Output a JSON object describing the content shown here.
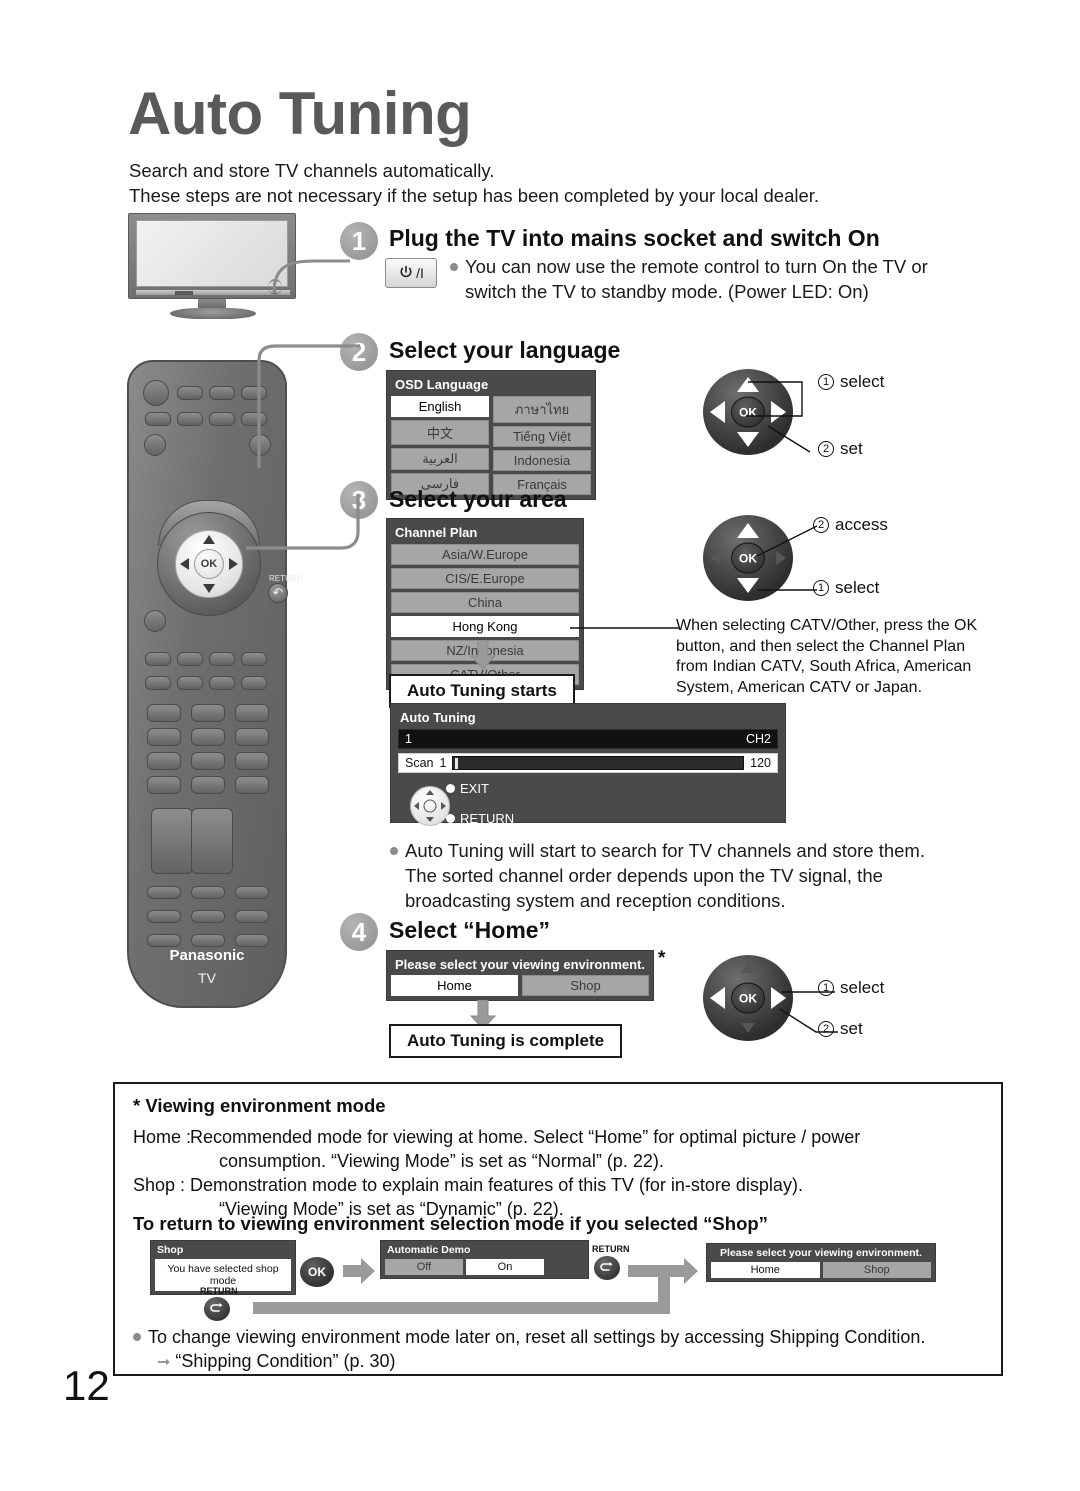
{
  "page": {
    "title": "Auto Tuning",
    "number": "12",
    "intro_line1": "Search and store TV channels automatically.",
    "intro_line2": "These steps are not necessary if the setup has been completed by your local dealer."
  },
  "step1": {
    "number": "1",
    "heading": "Plug the TV into mains socket and switch On",
    "power_button_label": "⏻/I",
    "bullet_line1": "You can now use the remote control to turn On the TV or",
    "bullet_line2": "switch the TV to standby mode. (Power LED: On)"
  },
  "step2": {
    "number": "2",
    "heading": "Select your language",
    "osd_title": "OSD Language",
    "options_col1": [
      "English",
      "中文",
      "العربية",
      "فارسی"
    ],
    "options_col2": [
      "ภาษาไทย",
      "Tiếng Việt",
      "Indonesia",
      "Français"
    ],
    "selected": "English",
    "callout1_num": "1",
    "callout1_label": "select",
    "callout2_num": "2",
    "callout2_label": "set"
  },
  "step3": {
    "number": "3",
    "heading": "Select your area",
    "osd_title": "Channel Plan",
    "options": [
      "Asia/W.Europe",
      "CIS/E.Europe",
      "China",
      "Hong Kong",
      "NZ/Indonesia",
      "CATV/Other"
    ],
    "selected": "Hong Kong",
    "callout1_num": "2",
    "callout1_label": "access",
    "callout2_num": "1",
    "callout2_label": "select",
    "note_line1": "When selecting CATV/Other, press the OK",
    "note_line2": "button, and then select the Channel Plan",
    "note_line3": "from Indian CATV, South Africa, American",
    "note_line4": "System, American CATV or Japan.",
    "starts_caption": "Auto Tuning starts"
  },
  "tuning_panel": {
    "title": "Auto Tuning",
    "channel_index": "1",
    "channel_name": "CH2",
    "scan_label": "Scan",
    "scan_current": "1",
    "scan_total": "120",
    "hint_exit": "EXIT",
    "hint_return": "RETURN",
    "bullet_line1": "Auto Tuning will start to search for TV channels and store them.",
    "bullet_line2": "The sorted channel order depends upon the TV signal, the",
    "bullet_line3": "broadcasting system and reception conditions."
  },
  "step4": {
    "number": "4",
    "heading": "Select “Home”",
    "dialog_title": "Please select your viewing environment.",
    "option_home": "Home",
    "option_shop": "Shop",
    "asterisk": "*",
    "complete_caption": "Auto Tuning is complete",
    "callout1_num": "1",
    "callout1_label": "select",
    "callout2_num": "2",
    "callout2_label": "set"
  },
  "note": {
    "heading": "* Viewing environment mode",
    "home_label": "Home :",
    "home_line1": "Recommended mode for viewing at home. Select “Home” for optimal picture / power",
    "home_line2": "consumption. “Viewing Mode” is set as “Normal” (p. 22).",
    "shop_label": "Shop  :",
    "shop_line1": "Demonstration mode to explain main features of this TV (for in-store display).",
    "shop_line2": "“Viewing Mode” is set as “Dynamic” (p. 22).",
    "heading2": "To return to viewing environment selection mode if you selected “Shop”"
  },
  "flow": {
    "shop_title": "Shop",
    "shop_message": "You have selected shop mode",
    "ok_label": "OK",
    "return_label": "RETURN",
    "return_label2": "RETURN",
    "demo_title": "Automatic Demo",
    "demo_off": "Off",
    "demo_on": "On",
    "env_title": "Please select your viewing environment.",
    "env_home": "Home",
    "env_shop": "Shop"
  },
  "final": {
    "bullet": "To change viewing environment mode later on, reset all settings by accessing Shipping Condition.",
    "sub": "“Shipping Condition” (p. 30)"
  },
  "remote": {
    "brand": "Panasonic",
    "model": "TV",
    "ok_label": "OK",
    "return_label": "RETURN",
    "return_glyph": "↶"
  }
}
